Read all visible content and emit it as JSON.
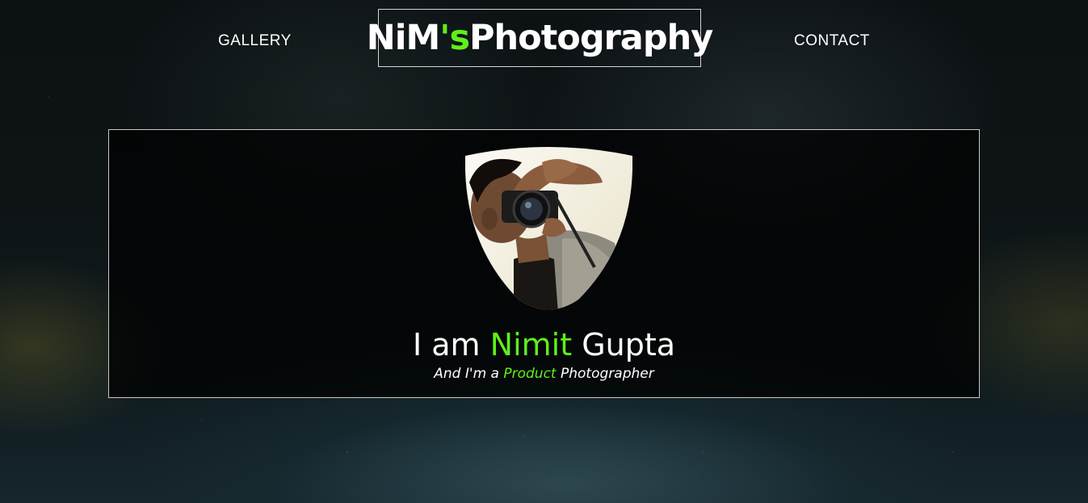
{
  "nav": {
    "gallery_label": "GALLERY",
    "contact_label": "CONTACT"
  },
  "logo": {
    "part1": "NiM",
    "part2": "'s",
    "part3": "Photography"
  },
  "hero": {
    "title_prefix": "I am",
    "title_name": "Nimit",
    "title_suffix": "Gupta",
    "subtitle_prefix": "And I'm a",
    "subtitle_accent": "Product",
    "subtitle_suffix": "Photographer"
  },
  "colors": {
    "accent": "#5ef01a",
    "text": "#ffffff",
    "border": "#c9c9c9"
  }
}
